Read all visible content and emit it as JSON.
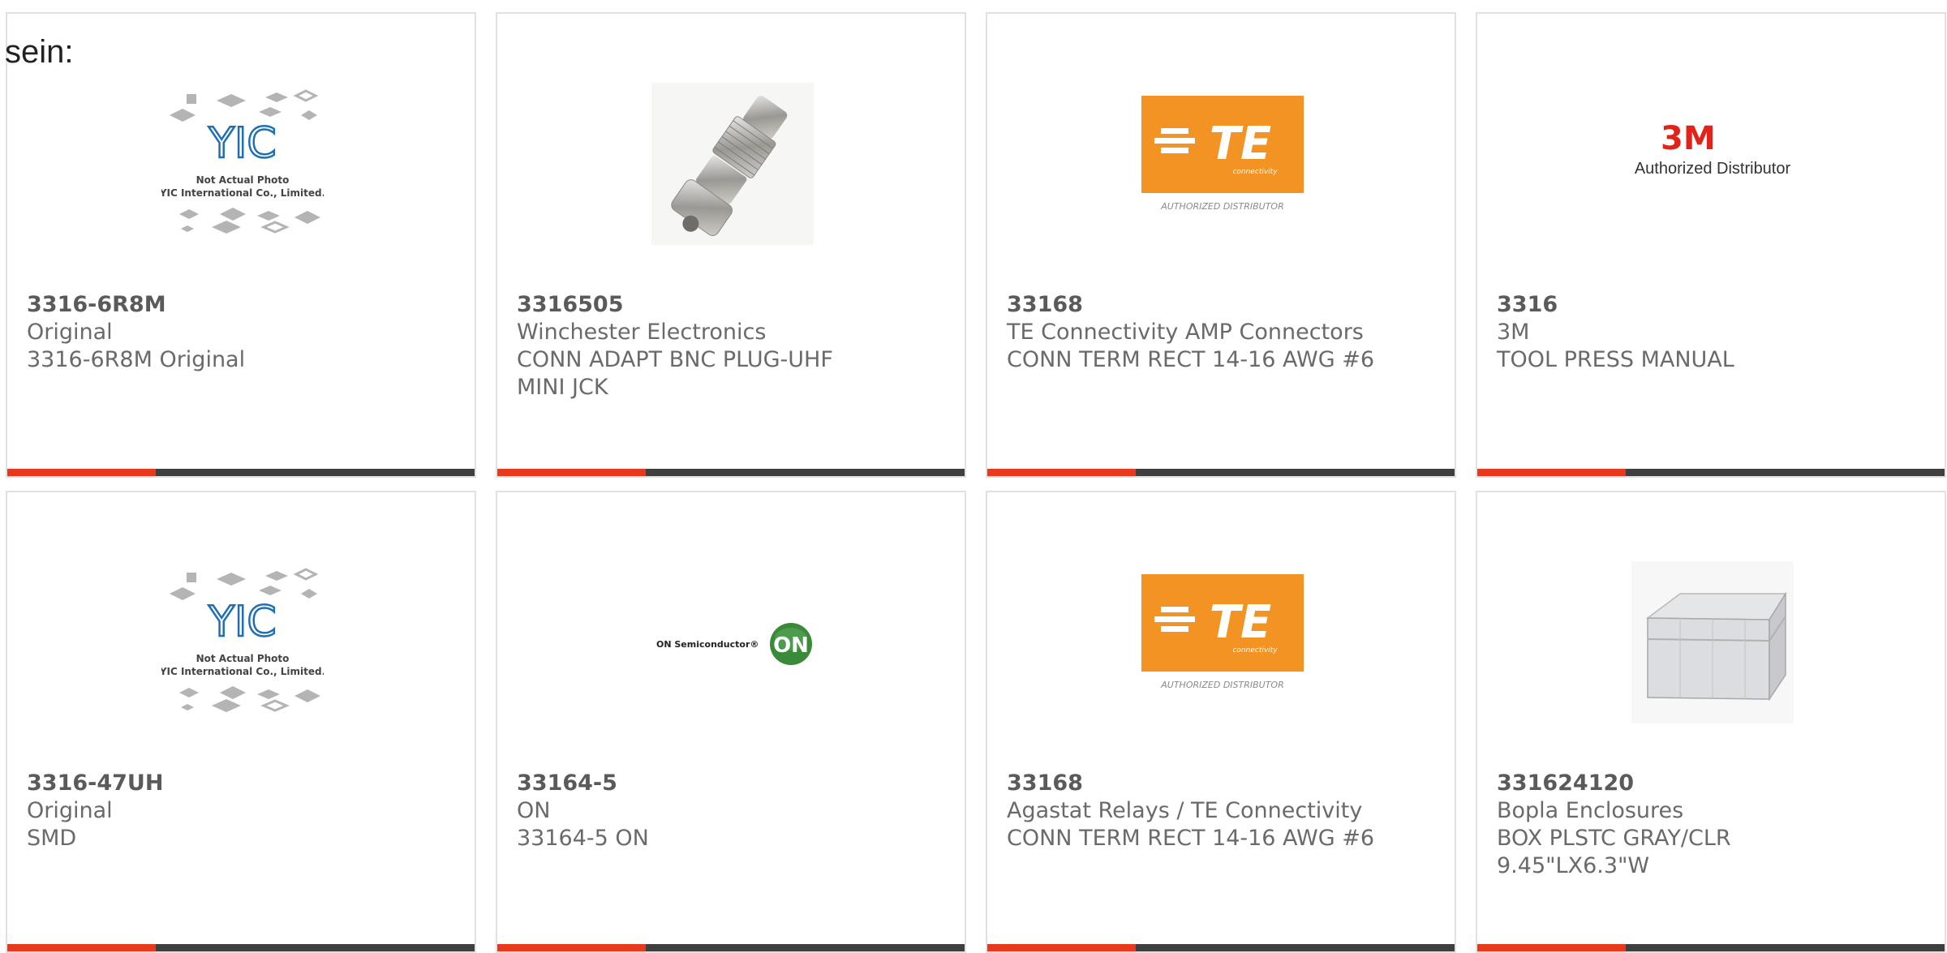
{
  "heading": "sein:",
  "colors": {
    "accent": "#e8391d",
    "bar": "#3f3f3f",
    "te_orange": "#f39324",
    "on_green": "#3a8a3a",
    "yic_blue": "#1f6fb5",
    "m3_red": "#e2231a"
  },
  "products": [
    {
      "part_number": "3316-6R8M",
      "line1": "Original",
      "line2": "3316-6R8M Original",
      "line3": "",
      "image": "yic-placeholder-icon"
    },
    {
      "part_number": "3316505",
      "line1": "Winchester Electronics",
      "line2": "CONN ADAPT BNC PLUG-UHF",
      "line3": "MINI JCK",
      "image": "bnc-adapter-photo"
    },
    {
      "part_number": "33168",
      "line1": "TE Connectivity AMP Connectors",
      "line2": "CONN TERM RECT 14-16 AWG #6",
      "line3": "",
      "image": "te-logo"
    },
    {
      "part_number": "3316",
      "line1": "3M",
      "line2": "TOOL PRESS MANUAL",
      "line3": "",
      "image": "3m-logo"
    },
    {
      "part_number": "3316-47UH",
      "line1": "Original",
      "line2": "SMD",
      "line3": "",
      "image": "yic-placeholder-icon"
    },
    {
      "part_number": "33164-5",
      "line1": "ON",
      "line2": "33164-5 ON",
      "line3": "",
      "image": "on-semiconductor-logo"
    },
    {
      "part_number": "33168",
      "line1": "Agastat Relays / TE Connectivity",
      "line2": "CONN TERM RECT 14-16 AWG #6",
      "line3": "",
      "image": "te-logo"
    },
    {
      "part_number": "331624120",
      "line1": "Bopla Enclosures",
      "line2": "BOX PLSTC GRAY/CLR",
      "line3": "9.45\"LX6.3\"W",
      "image": "enclosure-box-photo"
    }
  ],
  "logos": {
    "yic": {
      "wordmark": "YIC",
      "caption1": "Not Actual Photo",
      "caption2": "YIC International Co., Limited."
    },
    "te": {
      "wordmark": "TE",
      "sub": "connectivity",
      "tagline": "AUTHORIZED DISTRIBUTOR"
    },
    "m3": {
      "wordmark": "3M",
      "tagline": "Authorized Distributor"
    },
    "on": {
      "text": "ON Semiconductor®",
      "badge": "ON"
    }
  }
}
